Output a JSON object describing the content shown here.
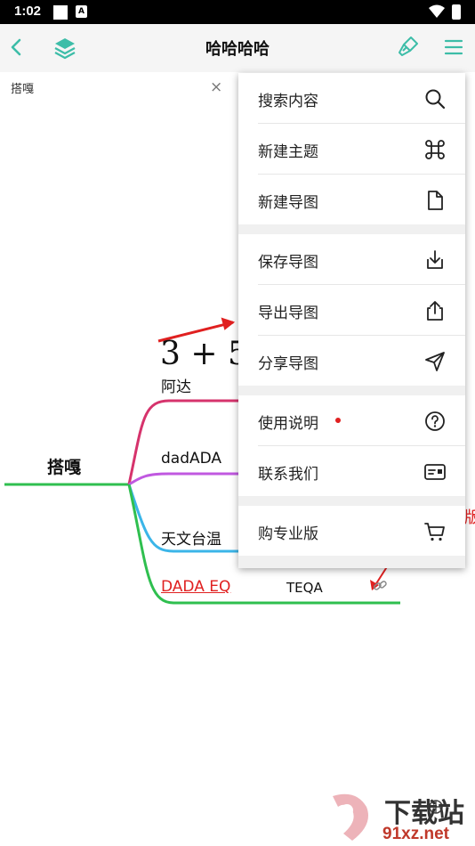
{
  "status_bar": {
    "time": "1:02",
    "notif_badge": "A"
  },
  "app_bar": {
    "title": "哈哈哈哈"
  },
  "sub_bar": {
    "label": "搭嘎",
    "close": "×"
  },
  "mindmap": {
    "root": "搭嘎",
    "formula": "3 + 5",
    "branches": [
      {
        "label": "阿达",
        "color": "#d6336c"
      },
      {
        "label": "dadADA",
        "color": "#c058e0"
      },
      {
        "label": "天文台温",
        "color": "#3bb5e8"
      },
      {
        "label": "DADA EQ",
        "color": "#2fbf4f",
        "link_color": "#e02020"
      }
    ],
    "child_node": "TEQA",
    "edge_text_fragment": "版"
  },
  "menu": {
    "groups": [
      [
        {
          "label": "搜索内容",
          "icon": "search-icon"
        },
        {
          "label": "新建主题",
          "icon": "command-icon"
        },
        {
          "label": "新建导图",
          "icon": "file-icon"
        }
      ],
      [
        {
          "label": "保存导图",
          "icon": "download-icon"
        },
        {
          "label": "导出导图",
          "icon": "upload-icon"
        },
        {
          "label": "分享导图",
          "icon": "send-icon"
        }
      ],
      [
        {
          "label": "使用说明",
          "icon": "help-icon",
          "has_dot": true
        },
        {
          "label": "联系我们",
          "icon": "contact-card-icon"
        }
      ],
      [
        {
          "label": "购专业版",
          "icon": "cart-icon"
        }
      ]
    ]
  },
  "watermark": {
    "text_top": "下载站",
    "text_bottom": "91xz.net"
  },
  "colors": {
    "accent": "#3dbda8",
    "annotation_red": "#e02020"
  }
}
